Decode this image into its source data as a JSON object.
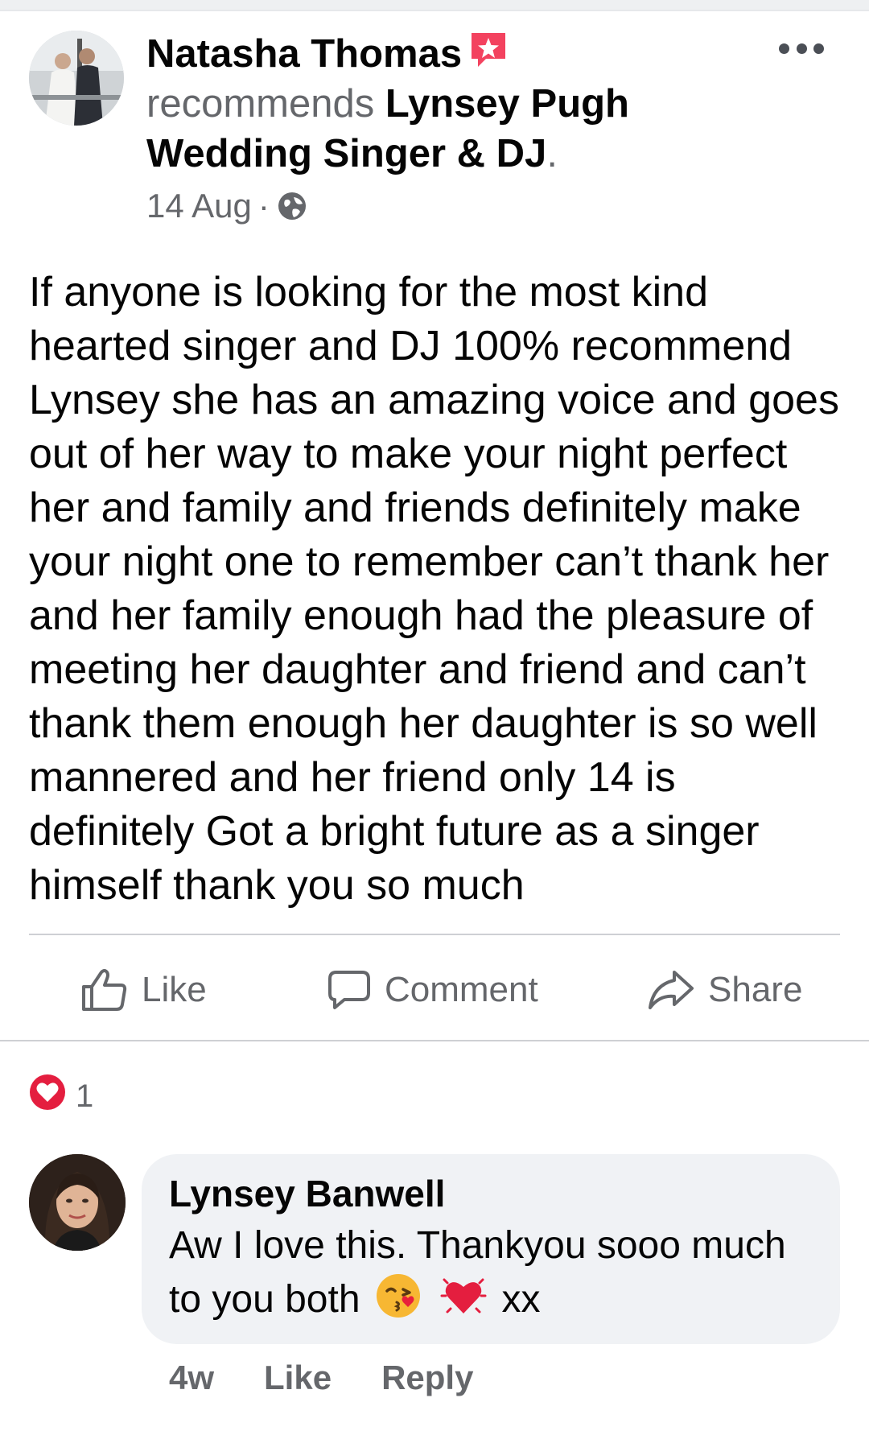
{
  "post": {
    "author": "Natasha Thomas",
    "recommends_word": "recommends",
    "page_name": "Lynsey Pugh Wedding Singer & DJ",
    "period": ".",
    "date": "14 Aug",
    "dot": "·",
    "privacy_icon": "globe-icon",
    "badge_icon": "recommendation-star-icon",
    "menu_icon": "more-options-icon",
    "text": "If anyone is looking for the most kind\nhearted singer and DJ 100% recommend\nLynsey she has an amazing voice and goes\nout of her way to make your night perfect\nher and family and friends definitely make\nyour night one to remember can’t thank her\nand her family enough had the pleasure of\nmeeting her daughter and friend and can’t\nthank them enough her daughter is so well\nmannered and her friend only 14 is\ndefinitely Got a bright future as a singer\nhimself thank you so much"
  },
  "actions": {
    "like_label": "Like",
    "comment_label": "Comment",
    "share_label": "Share"
  },
  "reactions": {
    "icon": "heart-reaction-icon",
    "count": "1"
  },
  "comment": {
    "author": "Lynsey Banwell",
    "text_before_emoji": "Aw I love this. Thankyou sooo much to you both",
    "emoji_1": "face-blowing-kiss-emoji",
    "emoji_2": "beating-heart-emoji",
    "text_after_emoji": "xx",
    "time": "4w",
    "like_label": "Like",
    "reply_label": "Reply"
  },
  "colors": {
    "muted_text": "#65676b",
    "bubble_bg": "#f0f2f5",
    "badge_pink": "#f3425f",
    "heart_red": "#e41e3f"
  }
}
